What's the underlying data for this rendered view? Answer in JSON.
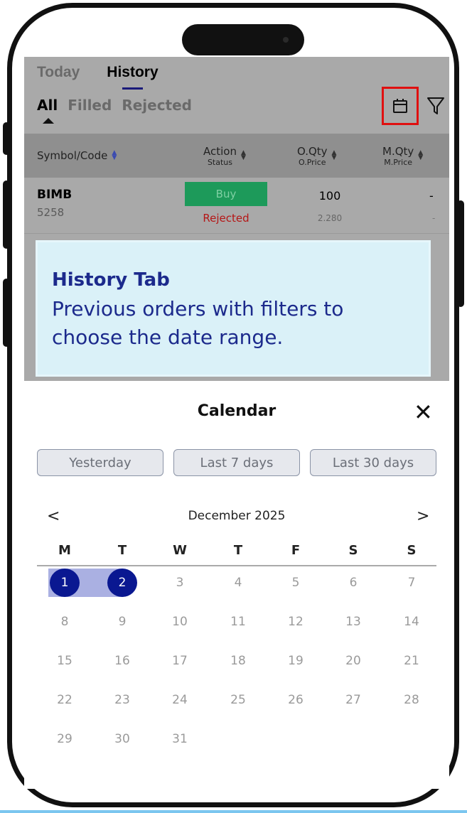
{
  "tabs": [
    {
      "label": "Today",
      "active": false
    },
    {
      "label": "History",
      "active": true
    }
  ],
  "subtabs": [
    {
      "label": "All",
      "active": true
    },
    {
      "label": "Filled",
      "active": false
    },
    {
      "label": "Rejected",
      "active": false
    }
  ],
  "icons": {
    "calendar": "calendar-icon",
    "filter": "filter-icon",
    "sort": "sort-icon",
    "close": "close-icon"
  },
  "table": {
    "headers": [
      {
        "line1": "Symbol/Code",
        "line2": ""
      },
      {
        "line1": "Action",
        "line2": "Status"
      },
      {
        "line1": "O.Qty",
        "line2": "O.Price"
      },
      {
        "line1": "M.Qty",
        "line2": "M.Price"
      }
    ],
    "rows": [
      {
        "symbol": "BIMB",
        "code": "5258",
        "action": "Buy",
        "status": "Rejected",
        "oqty": "100",
        "oprice": "2.280",
        "mqty": "-",
        "mprice": "-"
      }
    ]
  },
  "callout": {
    "title": "History Tab",
    "body": "Previous orders with filters to choose the date range."
  },
  "calendar": {
    "title": "Calendar",
    "quick_ranges": [
      "Yesterday",
      "Last 7 days",
      "Last 30 days"
    ],
    "month": "December 2025",
    "prev": "<",
    "next": ">",
    "weekdays": [
      "M",
      "T",
      "W",
      "T",
      "F",
      "S",
      "S"
    ],
    "days": [
      "1",
      "2",
      "3",
      "4",
      "5",
      "6",
      "7",
      "8",
      "9",
      "10",
      "11",
      "12",
      "13",
      "14",
      "15",
      "16",
      "17",
      "18",
      "19",
      "20",
      "21",
      "22",
      "23",
      "24",
      "25",
      "26",
      "27",
      "28",
      "29",
      "30",
      "31"
    ],
    "selected": [
      "1",
      "2"
    ],
    "colors": {
      "selected": "#0a1891",
      "range": "#aab0e2",
      "buy": "#1d9a5a",
      "rejected": "#b51616",
      "highlight_box": "#e01010"
    }
  }
}
